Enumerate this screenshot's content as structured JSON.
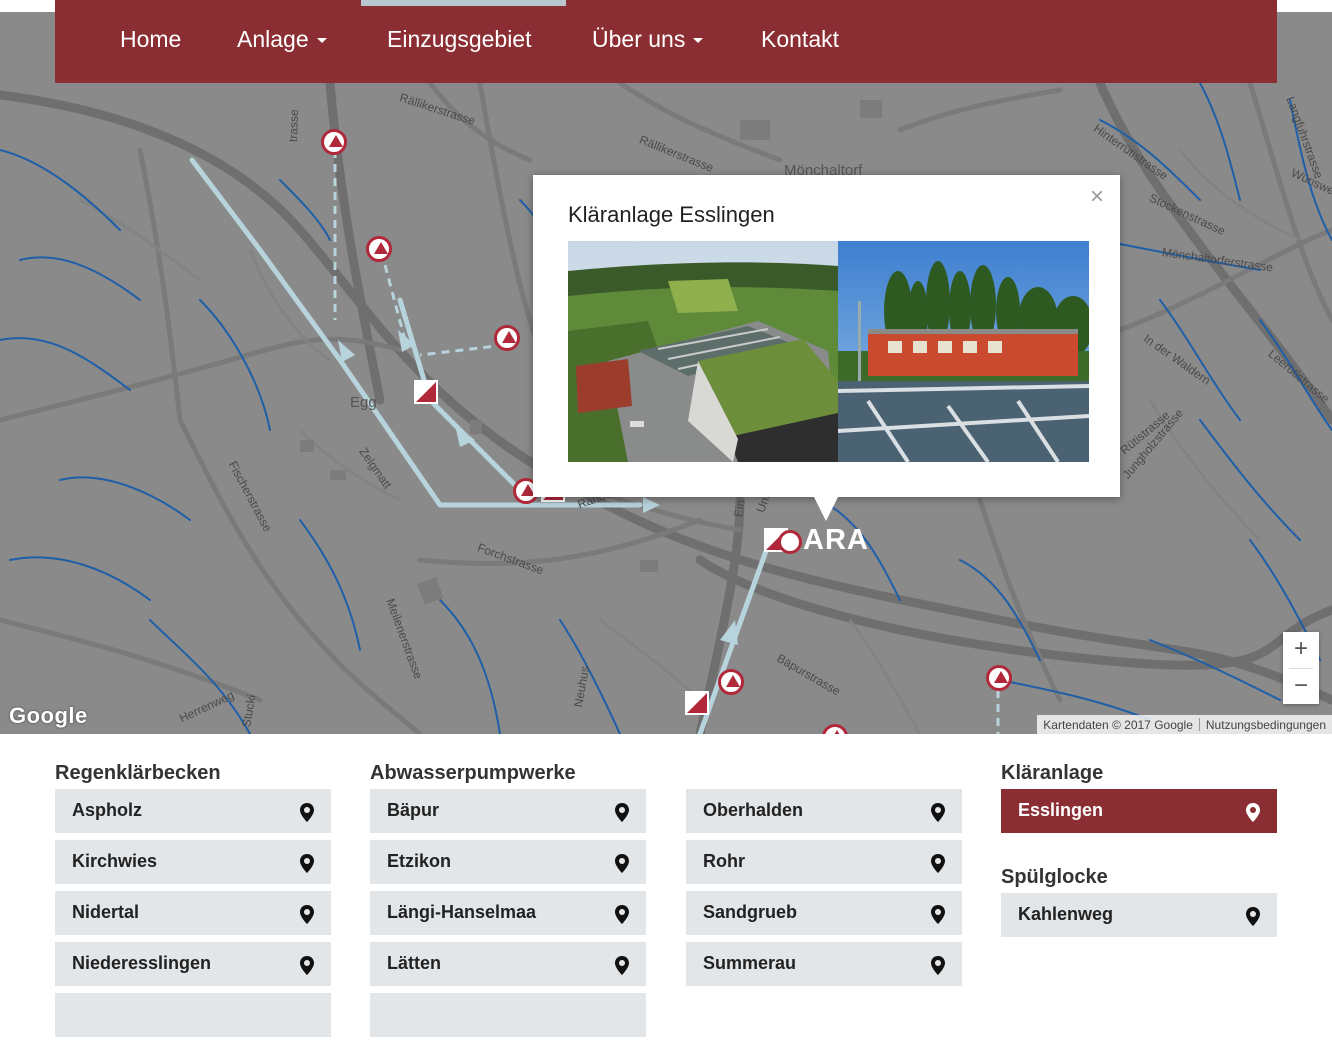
{
  "nav": {
    "items": [
      {
        "label": "Home",
        "dropdown": false
      },
      {
        "label": "Anlage",
        "dropdown": true
      },
      {
        "label": "Einzugsgebiet",
        "dropdown": false,
        "active": true
      },
      {
        "label": "Über uns",
        "dropdown": true
      },
      {
        "label": "Kontakt",
        "dropdown": false
      }
    ],
    "brand_color": "#8b2e33",
    "active_indicator_color": "#b7c9cf"
  },
  "map": {
    "place_labels": [
      "Mönchaltorf",
      "Egg"
    ],
    "street_labels": [
      "Rällikerstrasse",
      "Rällikerstrasse",
      "Langfuhrstrasse",
      "Würisweg",
      "Hinterrütistrasse",
      "Stockenstrasse",
      "Mönchaltorferstrasse",
      "In der Waldern",
      "Leerütistrasse",
      "Jungholzstrasse",
      "Fischerstrasse",
      "Zelgmatt",
      "Forchstrasse",
      "Meilenerstrasse",
      "Bäpurstrasse",
      "Herrenweg",
      "Neuhus",
      "Randel",
      "Unter",
      "Ein",
      "Stucki",
      "Rütistrasse",
      "trasse"
    ],
    "ara_label": "ARA",
    "google_logo": "Google",
    "attribution": [
      "Kartendaten © 2017 Google",
      "Nutzungsbedingungen"
    ],
    "zoom_in": "+",
    "zoom_out": "−",
    "water_color": "#1f5fa8",
    "route_color": "#b7d3dc",
    "marker_color": "#b0283a"
  },
  "popup": {
    "title": "Kläranlage Esslingen",
    "close": "×"
  },
  "lists": {
    "regenklaerbecken": {
      "heading": "Regenklärbecken",
      "items": [
        "Aspholz",
        "Kirchwies",
        "Nidertal",
        "Niederesslingen"
      ]
    },
    "abwasserpumpwerke": {
      "heading": "Abwasserpumpwerke",
      "items": [
        "Bäpur",
        "Etzikon",
        "Längi-Hanselmaa",
        "Lätten"
      ]
    },
    "abwasserpumpwerke_2": {
      "items": [
        "Oberhalden",
        "Rohr",
        "Sandgrueb",
        "Summerau"
      ]
    },
    "klaeranlage": {
      "heading": "Kläranlage",
      "items": [
        "Esslingen"
      ],
      "active": "Esslingen"
    },
    "spuelglocke": {
      "heading": "Spülglocke",
      "items": [
        "Kahlenweg"
      ]
    }
  }
}
